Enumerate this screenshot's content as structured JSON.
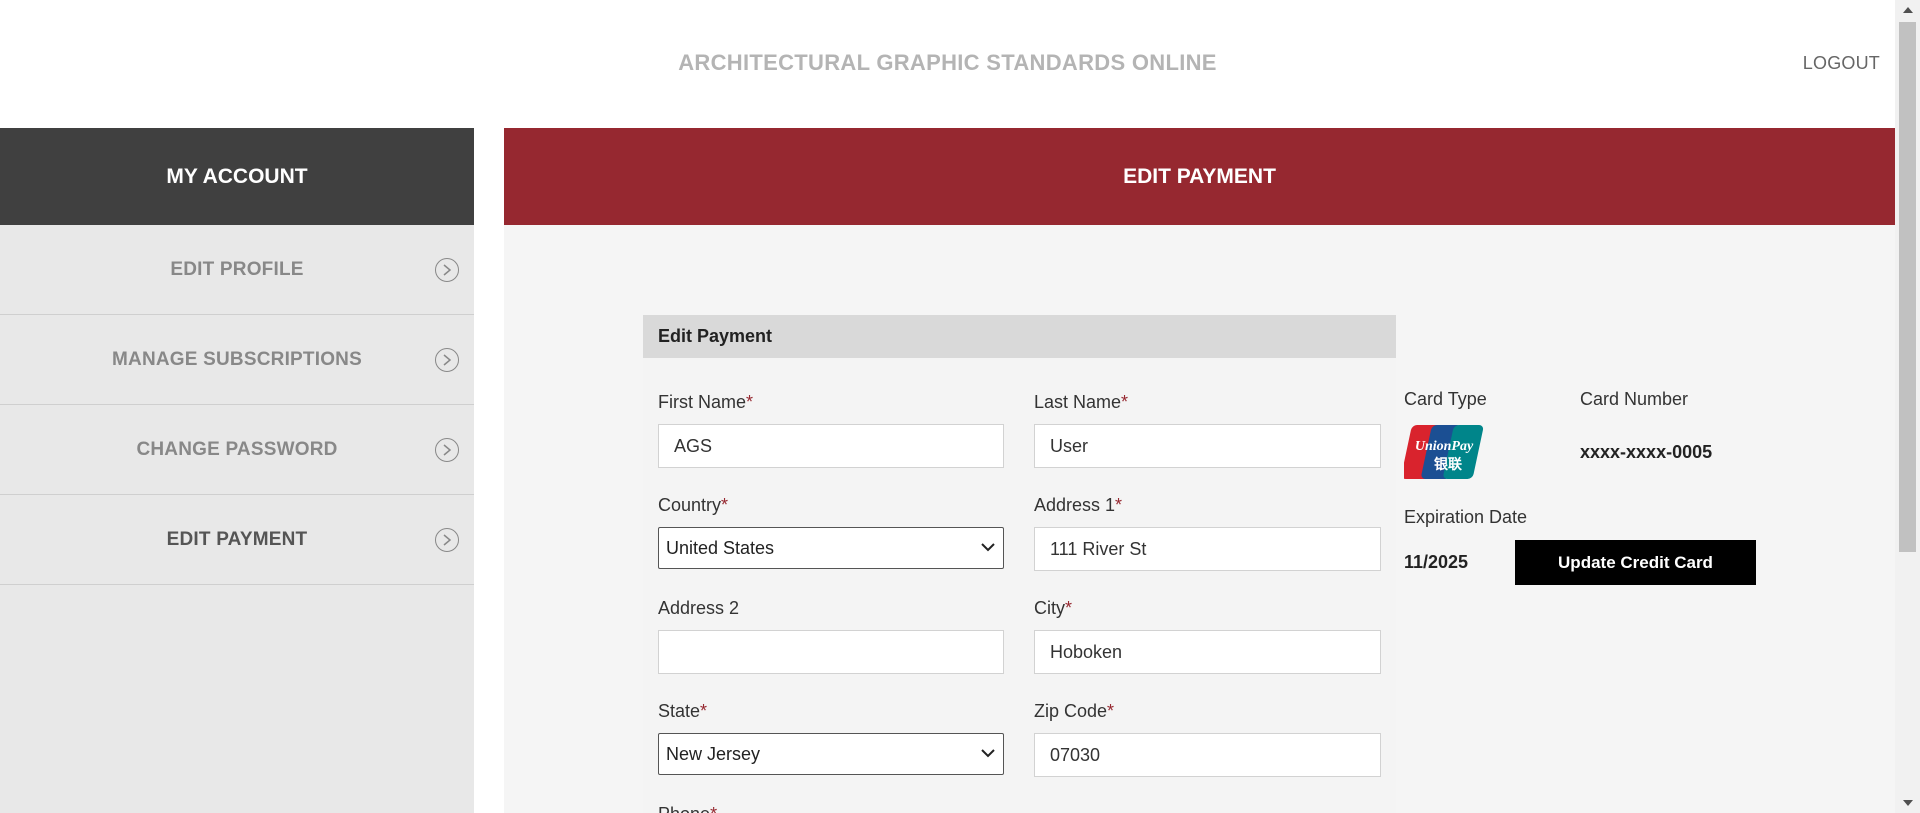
{
  "header": {
    "site_title": "ARCHITECTURAL GRAPHIC STANDARDS ONLINE",
    "logout_label": "LOGOUT"
  },
  "sidebar": {
    "title": "MY ACCOUNT",
    "items": [
      {
        "label": "EDIT PROFILE",
        "icon": "chevron-right-circle-icon"
      },
      {
        "label": "MANAGE SUBSCRIPTIONS",
        "icon": "chevron-right-circle-icon"
      },
      {
        "label": "CHANGE PASSWORD",
        "icon": "chevron-right-circle-icon"
      },
      {
        "label": "EDIT PAYMENT",
        "icon": "chevron-right-circle-icon",
        "active": true
      }
    ]
  },
  "main": {
    "title": "EDIT PAYMENT"
  },
  "form": {
    "section_title": "Edit Payment",
    "required_marker": "*",
    "first_name": {
      "label": "First Name",
      "value": "AGS"
    },
    "last_name": {
      "label": "Last Name",
      "value": "User"
    },
    "country": {
      "label": "Country",
      "value": "United States"
    },
    "address1": {
      "label": "Address 1",
      "value": "111 River St"
    },
    "address2": {
      "label": "Address 2",
      "value": ""
    },
    "city": {
      "label": "City",
      "value": "Hoboken"
    },
    "state": {
      "label": "State",
      "value": "New Jersey"
    },
    "zip": {
      "label": "Zip Code",
      "value": "07030"
    },
    "phone": {
      "label": "Phone"
    }
  },
  "card": {
    "type_label": "Card Type",
    "type_value": "UnionPay",
    "logo_text_top": "UnionPay",
    "logo_text_bottom": "银联",
    "number_label": "Card Number",
    "number_value": "xxxx-xxxx-0005",
    "expiration_label": "Expiration Date",
    "expiration_value": "11/2025",
    "update_button_label": "Update Credit Card"
  },
  "colors": {
    "main_header_bg": "#962830",
    "sidebar_header_bg": "#404040",
    "required": "#962830"
  }
}
